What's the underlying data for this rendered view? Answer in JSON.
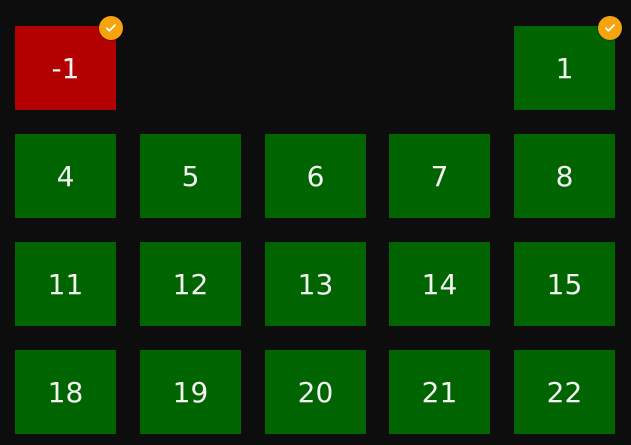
{
  "tiles": {
    "t_minus1": {
      "label": "-1",
      "state": "selected",
      "color": "#b30000"
    },
    "t_1": {
      "label": "1",
      "state": "selected",
      "color": "#006400"
    },
    "t_4": {
      "label": "4"
    },
    "t_5": {
      "label": "5"
    },
    "t_6": {
      "label": "6"
    },
    "t_7": {
      "label": "7"
    },
    "t_8": {
      "label": "8"
    },
    "t_11": {
      "label": "11"
    },
    "t_12": {
      "label": "12"
    },
    "t_13": {
      "label": "13"
    },
    "t_14": {
      "label": "14"
    },
    "t_15": {
      "label": "15"
    },
    "t_18": {
      "label": "18"
    },
    "t_19": {
      "label": "19"
    },
    "t_20": {
      "label": "20"
    },
    "t_21": {
      "label": "21"
    },
    "t_22": {
      "label": "22"
    }
  },
  "colors": {
    "background": "#0d0d0d",
    "tile_green": "#006400",
    "tile_red": "#b30000",
    "check_badge": "#f5a40f"
  },
  "icons": {
    "selected_badge": "checkmark-icon"
  }
}
